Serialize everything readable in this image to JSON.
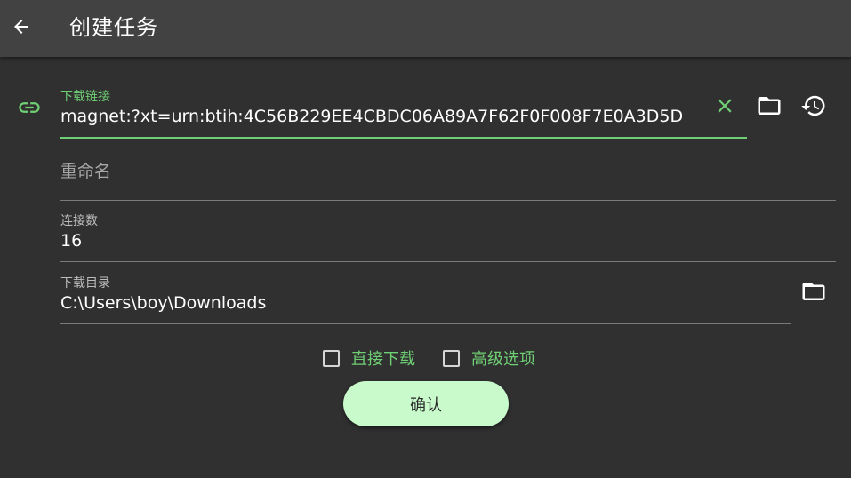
{
  "appbar": {
    "title": "创建任务",
    "back_icon": "arrow-left-icon"
  },
  "colors": {
    "accent": "#6fcf74",
    "background": "#303030",
    "appbar": "#424242",
    "button_bg": "#c8facb"
  },
  "form": {
    "link": {
      "label": "下载链接",
      "value": "magnet:?xt=urn:btih:4C56B229EE4CBDC06A89A7F62F0F008F7E0A3D5D",
      "icon": "link-icon",
      "actions": [
        "close-icon",
        "folder-icon",
        "history-icon"
      ]
    },
    "rename": {
      "placeholder": "重命名"
    },
    "connections": {
      "label": "连接数",
      "value": "16"
    },
    "directory": {
      "label": "下载目录",
      "value": "C:\\Users\\boy\\Downloads",
      "action_icon": "folder-icon"
    }
  },
  "options": {
    "direct_download": {
      "label": "直接下载",
      "checked": false
    },
    "advanced": {
      "label": "高级选项",
      "checked": false
    }
  },
  "confirm_label": "确认"
}
